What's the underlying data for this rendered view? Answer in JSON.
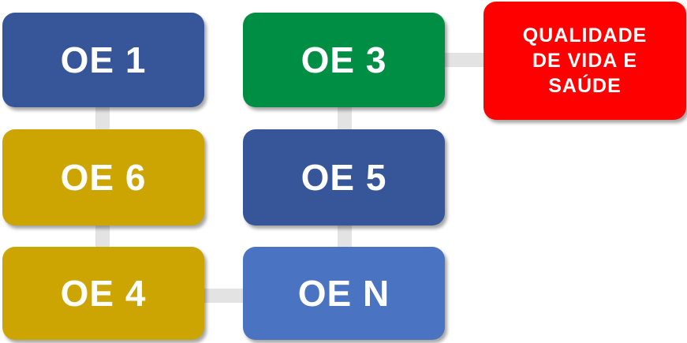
{
  "nodes": {
    "oe1": {
      "label": "OE 1",
      "color": "#365699"
    },
    "oe3": {
      "label": "OE 3",
      "color": "#008e44"
    },
    "quality": {
      "label": "QUALIDADE\nDE VIDA E\nSAÚDE",
      "color": "#ff0000"
    },
    "oe6": {
      "label": "OE 6",
      "color": "#cca502"
    },
    "oe5": {
      "label": "OE 5",
      "color": "#365699"
    },
    "oe4": {
      "label": "OE 4",
      "color": "#cca502"
    },
    "oeN": {
      "label": "OE N",
      "color": "#4a73c2"
    }
  },
  "connector_color": "#e3e3e3"
}
